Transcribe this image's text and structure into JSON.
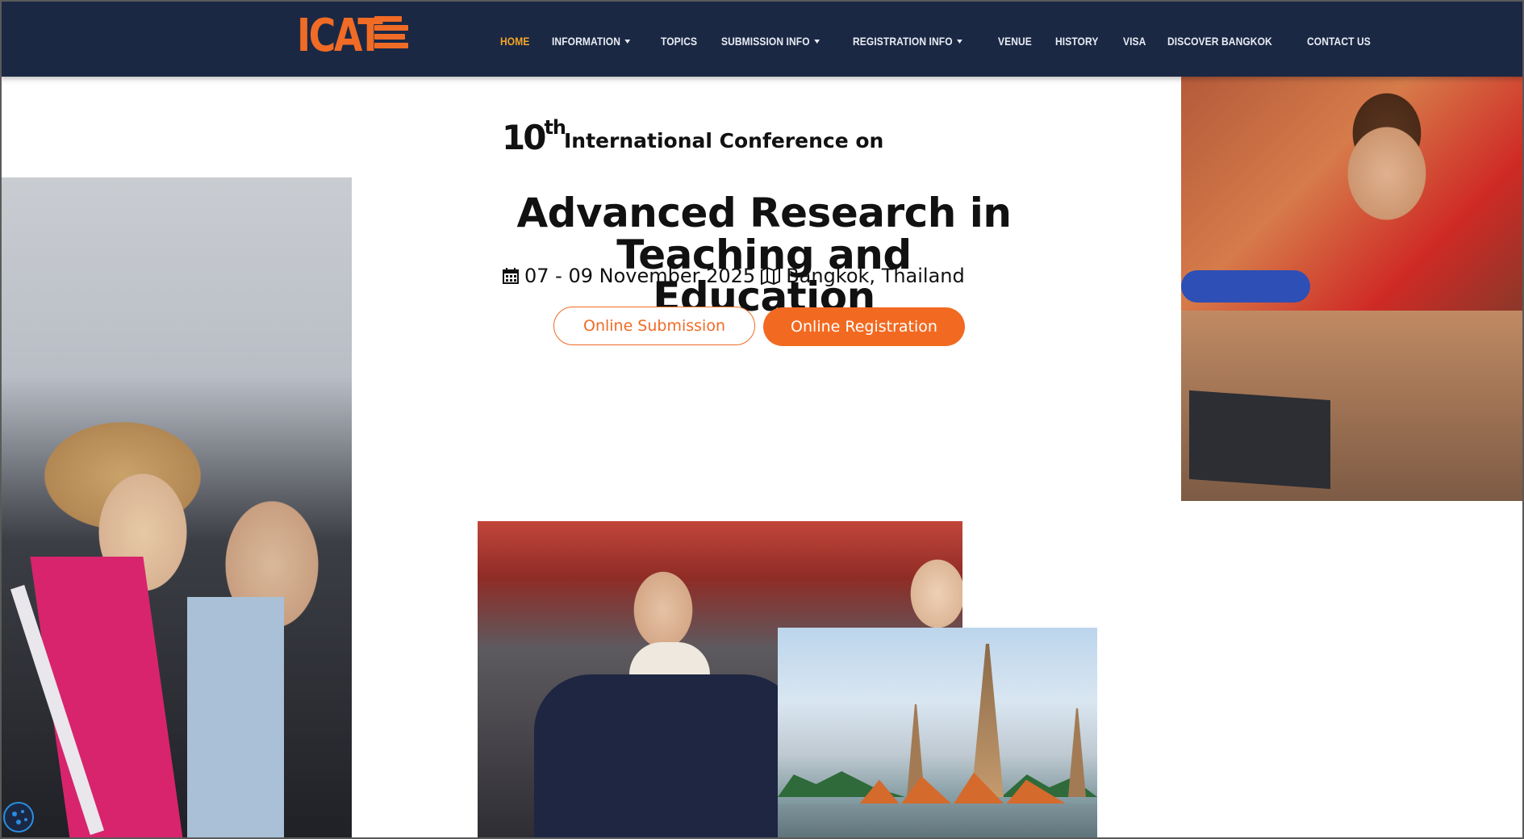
{
  "brand": {
    "logo_text": "ICAT",
    "accent_color": "#f06b25",
    "nav_bg_color": "#1b2844",
    "active_nav_color": "#f5a623"
  },
  "nav": {
    "items": [
      {
        "label": "HOME",
        "active": true,
        "dropdown": false
      },
      {
        "label": "INFORMATION",
        "active": false,
        "dropdown": true
      },
      {
        "label": "TOPICS",
        "active": false,
        "dropdown": false
      },
      {
        "label": "SUBMISSION INFO",
        "active": false,
        "dropdown": true
      },
      {
        "label": "REGISTRATION INFO",
        "active": false,
        "dropdown": true
      },
      {
        "label": "VENUE",
        "active": false,
        "dropdown": false
      },
      {
        "label": "HISTORY",
        "active": false,
        "dropdown": false
      },
      {
        "label": "VISA",
        "active": false,
        "dropdown": false
      },
      {
        "label": "DISCOVER BANGKOK",
        "active": false,
        "dropdown": false
      },
      {
        "label": "CONTACT US",
        "active": false,
        "dropdown": false
      }
    ]
  },
  "hero": {
    "ordinal_number": "10",
    "ordinal_suffix": "th",
    "subtitle": "International Conference on",
    "title_line1": "Advanced Research in",
    "title_line2": "Teaching and Education",
    "date": "07 - 09 November 2025",
    "location": "Bangkok, Thailand",
    "date_icon": "calendar-icon",
    "location_icon": "map-icon"
  },
  "buttons": {
    "submission": "Online Submission",
    "registration": "Online Registration"
  },
  "widgets": {
    "cookie_icon": "cookie-settings-icon"
  }
}
